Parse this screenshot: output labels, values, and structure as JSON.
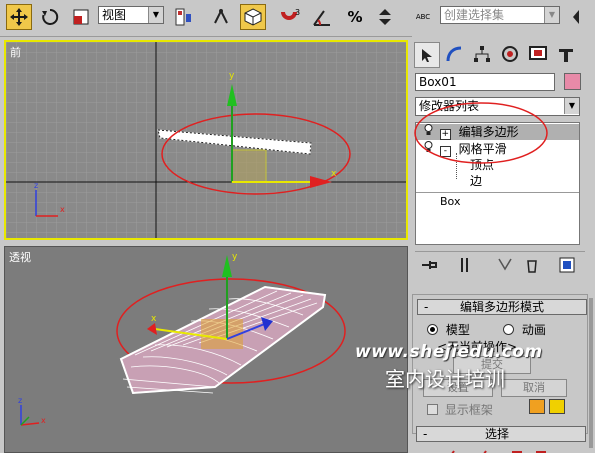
{
  "toolbar": {
    "view_select": "视图",
    "named_selection_placeholder": "创建选择集",
    "percent_label": "%",
    "abc_label": "ABC"
  },
  "viewports": {
    "front_label": "前",
    "persp_label": "透视"
  },
  "panel": {
    "object_name": "Box01",
    "object_color": "#e88aa8",
    "modifier_list": "修改器列表",
    "stack": [
      {
        "label": "编辑多边形",
        "level": 0,
        "expand": "+"
      },
      {
        "label": "网格平滑",
        "level": 0,
        "expand": "-"
      },
      {
        "label": "顶点",
        "level": 1
      },
      {
        "label": "边",
        "level": 1
      },
      {
        "label": "Box",
        "level": 0
      }
    ],
    "rollout_title": "编辑多边形模式",
    "radio_model": "模型",
    "radio_anim": "动画",
    "no_current_op": "<无当前操作>",
    "commit_btn": "提交",
    "settings_btn": "设置",
    "cancel_btn": "取消",
    "show_cage": "显示框架",
    "cage_colors": [
      "#f0a020",
      "#f0d000"
    ],
    "select_rollout": "选择"
  },
  "watermark": {
    "url": "www.shejiedu.com",
    "caption": "室内设计培训"
  }
}
